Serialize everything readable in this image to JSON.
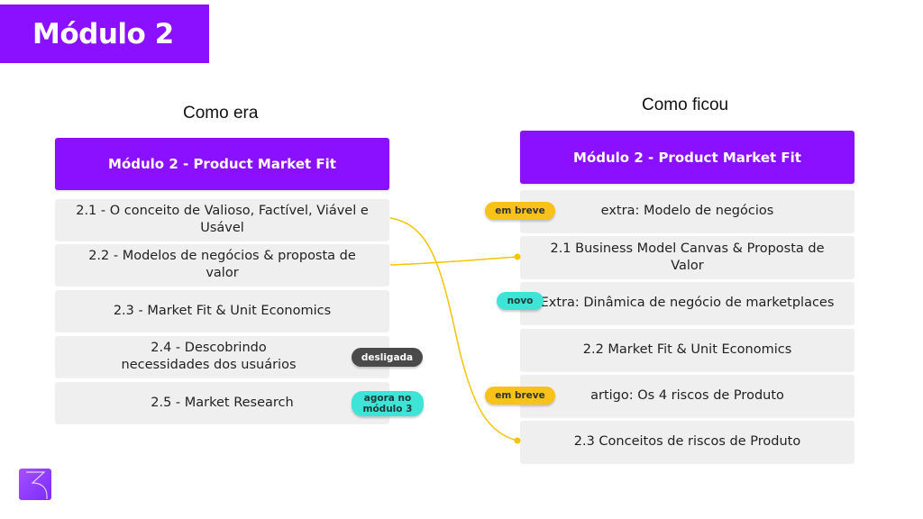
{
  "title": "Módulo 2",
  "columns": {
    "before": {
      "heading": "Como era",
      "header": "Módulo 2 - Product Market Fit",
      "items": [
        {
          "label": "2.1 - O conceito de Valioso, Factível, Viável e Usável"
        },
        {
          "label": "2.2 - Modelos de negócios & proposta de valor"
        },
        {
          "label": "2.3 - Market Fit & Unit Economics"
        },
        {
          "label": "2.4 - Descobrindo necessidades dos usuários",
          "badge": "desligada"
        },
        {
          "label": "2.5 - Market Research",
          "badge": "agora no módulo 3"
        }
      ]
    },
    "after": {
      "heading": "Como ficou",
      "header": "Módulo 2 - Product Market Fit",
      "items": [
        {
          "label": "extra: Modelo de negócios",
          "badge": "em breve"
        },
        {
          "label": "2.1 Business Model Canvas & Proposta de Valor"
        },
        {
          "label": "Extra: Dinâmica de negócio de marketplaces",
          "badge": "novo"
        },
        {
          "label": "2.2 Market Fit & Unit Economics"
        },
        {
          "label": "artigo: Os 4 riscos de Produto",
          "badge": "em breve"
        },
        {
          "label": "2.3 Conceitos de riscos de Produto"
        }
      ]
    }
  },
  "connections": [
    {
      "from": "2.1 - O conceito de Valioso, Factível, Viável e Usável",
      "to": "2.3 Conceitos de riscos de Produto"
    },
    {
      "from": "2.2 - Modelos de negócios & proposta de valor",
      "to": "2.1 Business Model Canvas & Proposta de Valor"
    }
  ],
  "colors": {
    "brand_purple": "#8a10ff",
    "connector": "#f5c400",
    "badge_yellow": "#f8c21a",
    "badge_teal": "#3fe4d6",
    "badge_dark": "#4a4a4a",
    "item_bg": "#efefef"
  },
  "logo": {
    "icon": "number-3-logo-icon"
  }
}
